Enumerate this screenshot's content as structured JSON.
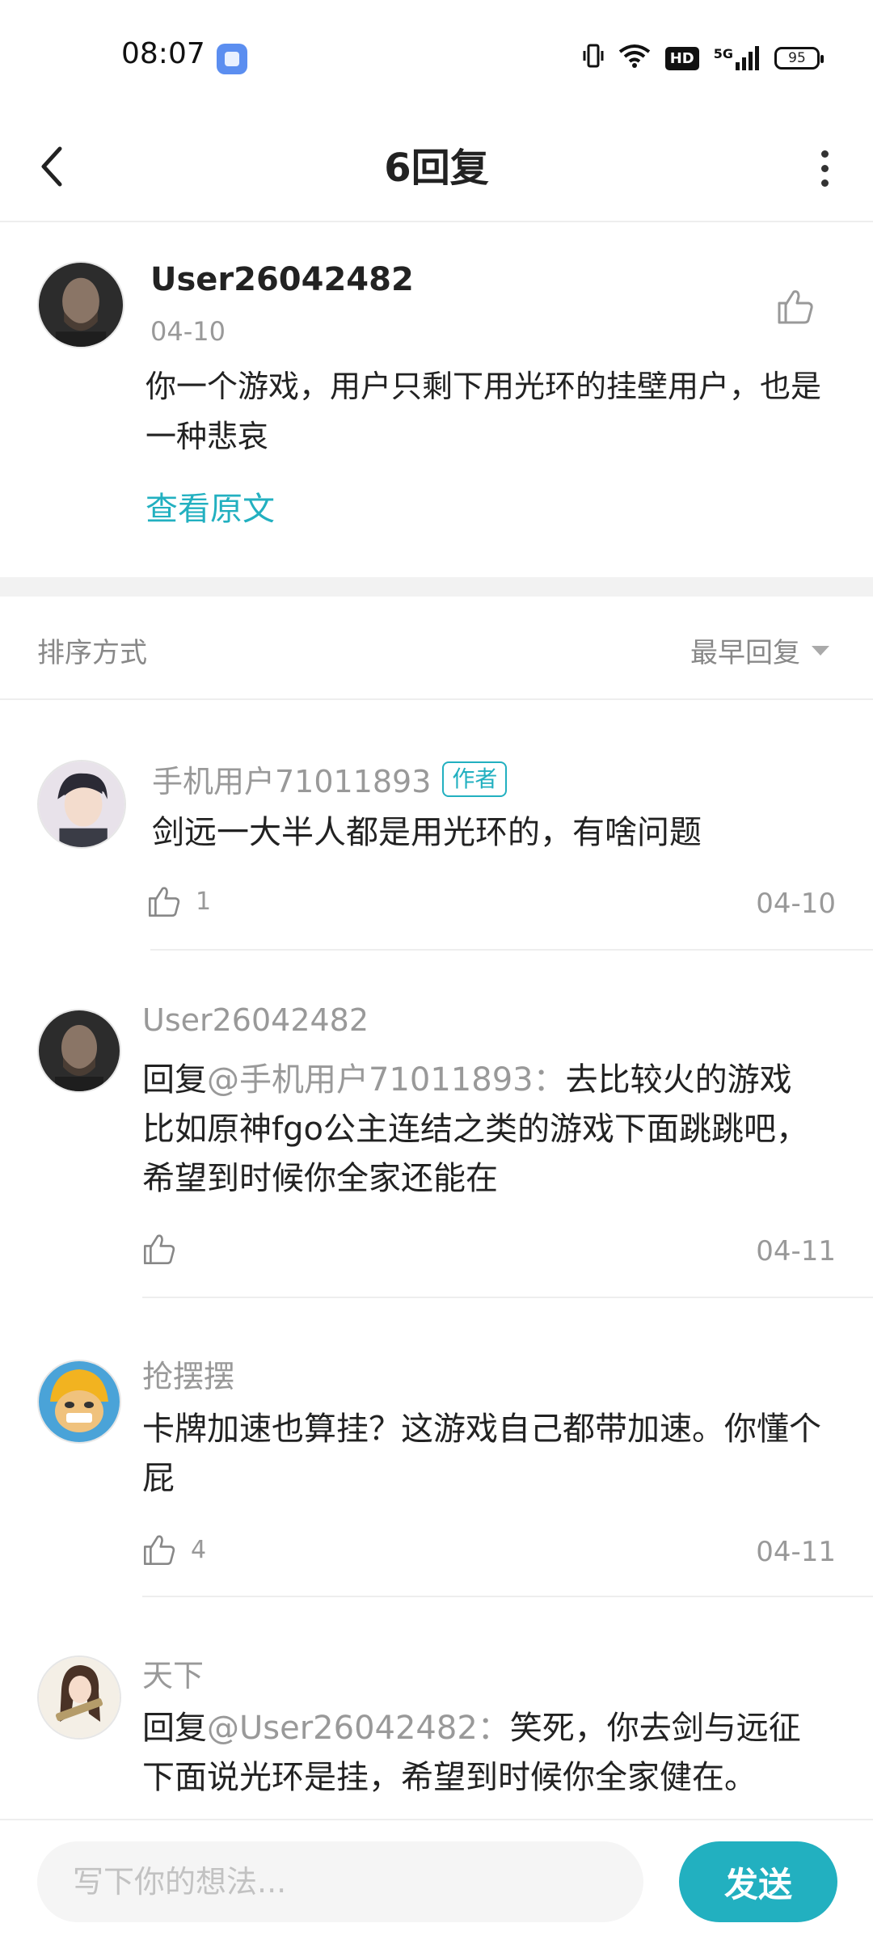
{
  "status_bar": {
    "time": "08:07",
    "network": "5G",
    "hd": "HD",
    "battery": "95"
  },
  "header": {
    "title": "6回复"
  },
  "main_post": {
    "username": "User26042482",
    "date": "04-10",
    "text": "你一个游戏，用户只剩下用光环的挂壁用户，也是一种悲哀",
    "view_original": "查看原文"
  },
  "sort": {
    "label": "排序方式",
    "value": "最早回复"
  },
  "replies": [
    {
      "username": "手机用户71011893",
      "badge": "作者",
      "reply_prefix": "",
      "mention": "",
      "separator": "",
      "text": "剑远一大半人都是用光环的，有啥问题",
      "likes": "1",
      "date": "04-10"
    },
    {
      "username": "User26042482",
      "badge": "",
      "reply_prefix": "回复",
      "mention": "@手机用户71011893",
      "separator": "：",
      "text": "去比较火的游戏比如原神fgo公主连结之类的游戏下面跳跳吧，希望到时候你全家还能在",
      "likes": "",
      "date": "04-11"
    },
    {
      "username": "抢摆摆",
      "badge": "",
      "reply_prefix": "",
      "mention": "",
      "separator": "",
      "text": "卡牌加速也算挂？这游戏自己都带加速。你懂个屁",
      "likes": "4",
      "date": "04-11"
    },
    {
      "username": "天下",
      "badge": "",
      "reply_prefix": "回复",
      "mention": "@User26042482",
      "separator": "：",
      "text": "笑死，你去剑与远征下面说光环是挂，希望到时候你全家健在。",
      "likes": "",
      "date": ""
    }
  ],
  "input": {
    "placeholder": "写下你的想法...",
    "value": ""
  },
  "send_button": "发送",
  "colors": {
    "accent": "#22b0c0",
    "text": "#222222",
    "muted": "#999999"
  }
}
